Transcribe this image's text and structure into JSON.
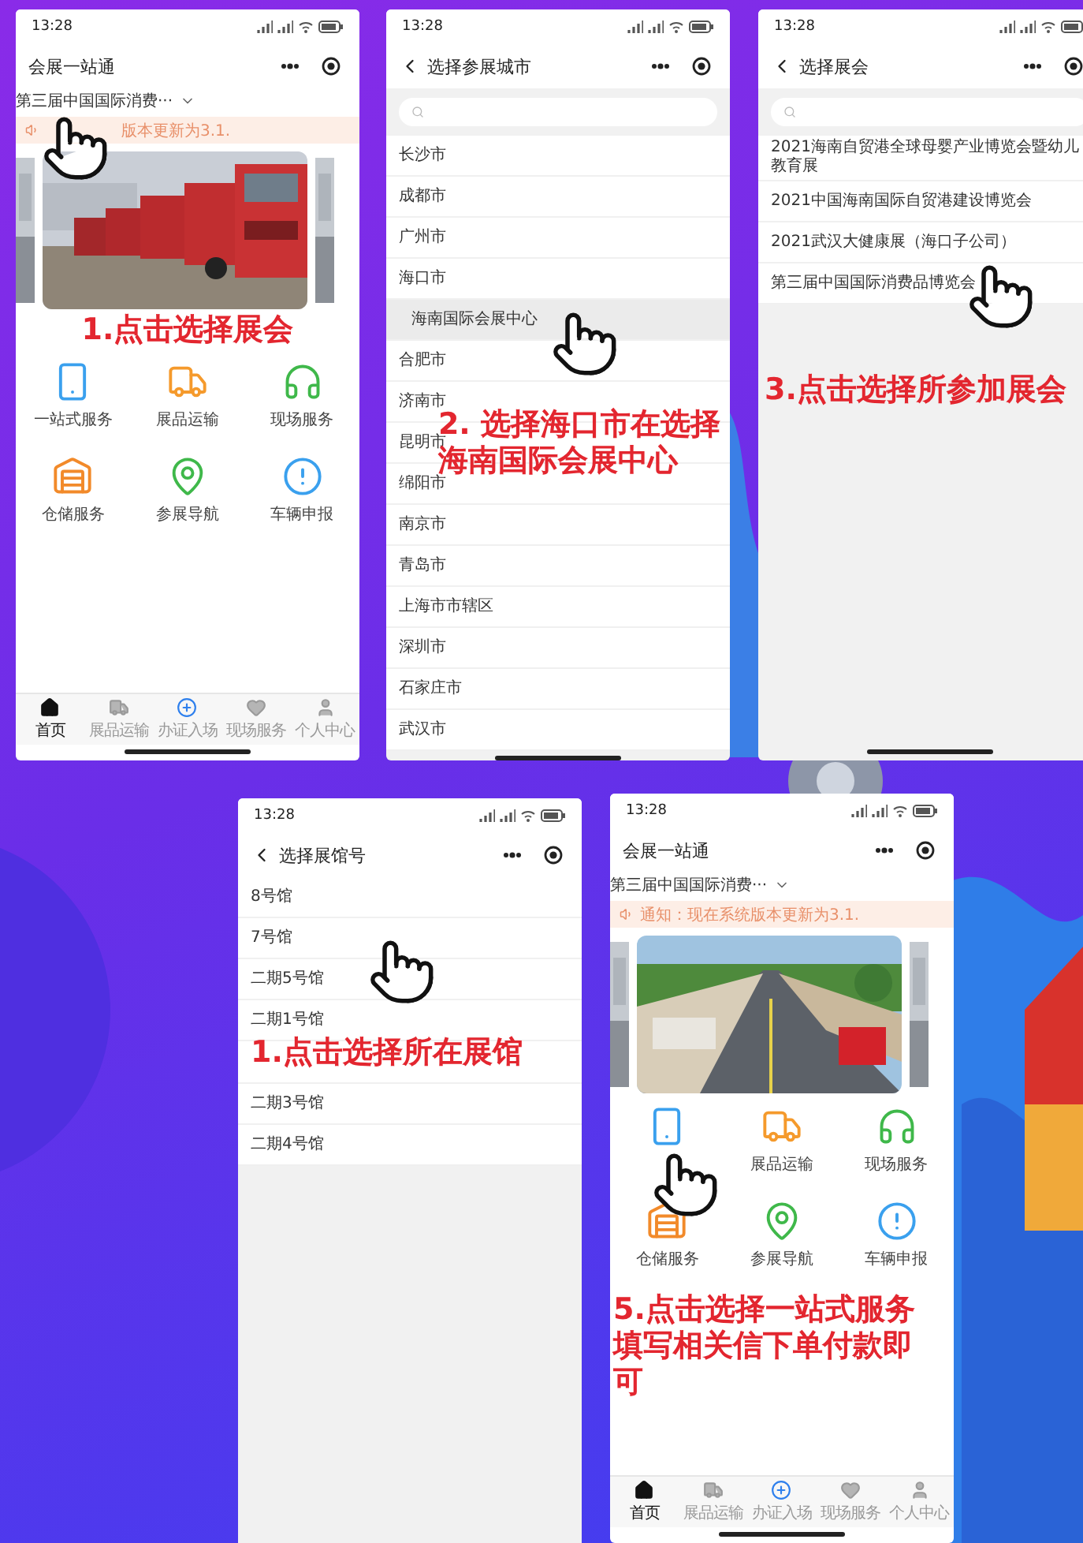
{
  "screens": [
    {
      "kind": "home",
      "time": "13:28",
      "title": "会展一站通",
      "event": "第三届中国国际消费···",
      "notice": "版本更新为3.1.",
      "services": [
        {
          "label": "一站式服务",
          "kind": "phone"
        },
        {
          "label": "展品运输",
          "kind": "truck"
        },
        {
          "label": "现场服务",
          "kind": "headset"
        },
        {
          "label": "仓储服务",
          "kind": "warehouse"
        },
        {
          "label": "参展导航",
          "kind": "pin"
        },
        {
          "label": "车辆申报",
          "kind": "alert"
        }
      ],
      "caption": [
        "1.点击选择展会"
      ],
      "tabs": [
        {
          "label": "首页",
          "kind": "home",
          "selected": true
        },
        {
          "label": "展品运输",
          "kind": "truck",
          "selected": false
        },
        {
          "label": "办证入场",
          "kind": "plus",
          "selected": false
        },
        {
          "label": "现场服务",
          "kind": "heart",
          "selected": false
        },
        {
          "label": "个人中心",
          "kind": "user",
          "selected": false
        }
      ]
    },
    {
      "kind": "list",
      "time": "13:28",
      "title": "选择参展城市",
      "search": true,
      "items": [
        {
          "label": "长沙市",
          "selected": false,
          "child": false
        },
        {
          "label": "成都市",
          "selected": false,
          "child": false
        },
        {
          "label": "广州市",
          "selected": false,
          "child": false
        },
        {
          "label": "海口市",
          "selected": false,
          "child": false
        },
        {
          "label": "海南国际会展中心",
          "selected": true,
          "child": true
        },
        {
          "label": "合肥市",
          "selected": false,
          "child": false
        },
        {
          "label": "济南市",
          "selected": false,
          "child": false
        },
        {
          "label": "昆明市",
          "selected": false,
          "child": false
        },
        {
          "label": "绵阳市",
          "selected": false,
          "child": false
        },
        {
          "label": "南京市",
          "selected": false,
          "child": false
        },
        {
          "label": "青岛市",
          "selected": false,
          "child": false
        },
        {
          "label": "上海市市辖区",
          "selected": false,
          "child": false
        },
        {
          "label": "深圳市",
          "selected": false,
          "child": false
        },
        {
          "label": "石家庄市",
          "selected": false,
          "child": false
        },
        {
          "label": "武汉市",
          "selected": false,
          "child": false
        }
      ],
      "caption": [
        "2. 选择海口市在选择",
        "海南国际会展中心"
      ]
    },
    {
      "kind": "list",
      "time": "13:28",
      "title": "选择展会",
      "search": true,
      "items": [
        {
          "label": "2021海南自贸港全球母婴产业博览会暨幼儿教育展",
          "selected": false,
          "child": false
        },
        {
          "label": "2021中国海南国际自贸港建设博览会",
          "selected": false,
          "child": false
        },
        {
          "label": "2021武汉大健康展（海口子公司）",
          "selected": false,
          "child": false
        },
        {
          "label": "第三届中国国际消费品博览会",
          "selected": false,
          "child": false
        }
      ],
      "caption": [
        "3.点击选择所参加展会"
      ]
    },
    {
      "kind": "list",
      "time": "13:28",
      "title": "选择展馆号",
      "search": false,
      "items": [
        {
          "label": "8号馆",
          "selected": false,
          "child": false
        },
        {
          "label": "7号馆",
          "selected": false,
          "child": false
        },
        {
          "label": "二期5号馆",
          "selected": false,
          "child": false
        },
        {
          "label": "二期1号馆",
          "selected": false,
          "child": false
        },
        {
          "label": "二期3号馆",
          "selected": false,
          "child": false
        },
        {
          "label": "二期4号馆",
          "selected": false,
          "child": false
        }
      ],
      "caption": [
        "1.点击选择所在展馆"
      ]
    },
    {
      "kind": "home",
      "time": "13:28",
      "title": "会展一站通",
      "event": "第三届中国国际消费···",
      "notice": "通知：现在系统版本更新为3.1.",
      "services": [
        {
          "kind": "phone"
        },
        {
          "label": "展品运输",
          "kind": "truck"
        },
        {
          "label": "现场服务",
          "kind": "headset"
        },
        {
          "label": "仓储服务",
          "kind": "warehouse"
        },
        {
          "label": "参展导航",
          "kind": "pin"
        },
        {
          "label": "车辆申报",
          "kind": "alert"
        }
      ],
      "caption": [
        "5.点击选择一站式服务填写相关信下单付款即可"
      ],
      "tabs": [
        {
          "label": "首页",
          "kind": "home",
          "selected": true
        },
        {
          "label": "展品运输",
          "kind": "truck",
          "selected": false
        },
        {
          "label": "办证入场",
          "kind": "plus",
          "selected": false
        },
        {
          "label": "现场服务",
          "kind": "heart",
          "selected": false
        },
        {
          "label": "个人中心",
          "kind": "user",
          "selected": false
        }
      ]
    }
  ]
}
